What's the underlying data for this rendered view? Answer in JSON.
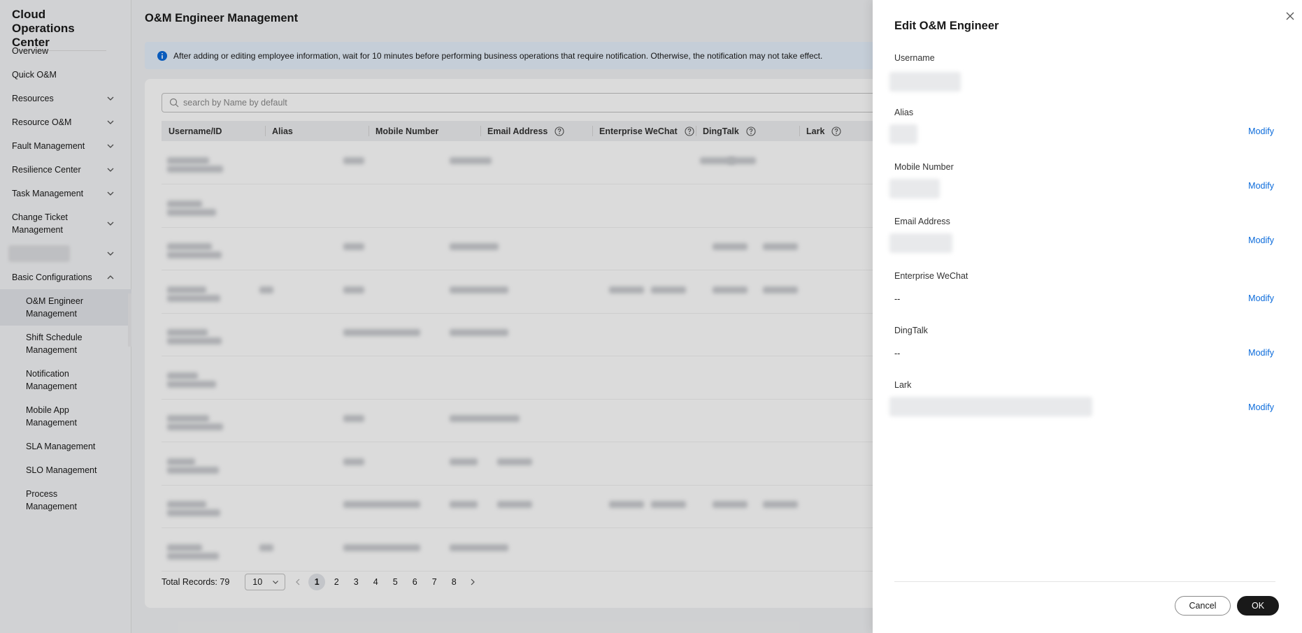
{
  "sidebar": {
    "title": "Cloud Operations Center",
    "items": [
      {
        "label": "Overview",
        "chevron": ""
      },
      {
        "label": "Quick O&M",
        "chevron": ""
      },
      {
        "label": "Resources",
        "chevron": "down"
      },
      {
        "label": "Resource O&M",
        "chevron": "down"
      },
      {
        "label": "Fault Management",
        "chevron": "down"
      },
      {
        "label": "Resilience Center",
        "chevron": "down"
      },
      {
        "label": "Task Management",
        "chevron": "down"
      },
      {
        "label": "Change Ticket Management",
        "chevron": "down"
      },
      {
        "label": "",
        "chevron": "down"
      },
      {
        "label": "Basic Configurations",
        "chevron": "up"
      }
    ],
    "sub_items": [
      {
        "label": "O&M Engineer Management",
        "active": true
      },
      {
        "label": "Shift Schedule Management",
        "active": false
      },
      {
        "label": "Notification Management",
        "active": false
      },
      {
        "label": "Mobile App Management",
        "active": false
      },
      {
        "label": "SLA Management",
        "active": false
      },
      {
        "label": "SLO Management",
        "active": false
      },
      {
        "label": "Process Management",
        "active": false
      }
    ]
  },
  "main": {
    "title": "O&M Engineer Management",
    "notice": "After adding or editing employee information, wait for 10 minutes before performing business operations that require notification. Otherwise, the notification may not take effect.",
    "search_placeholder": "search by Name by default",
    "columns": [
      "Username/ID",
      "Alias",
      "Mobile Number",
      "Email Address",
      "Enterprise WeChat",
      "DingTalk",
      "Lark"
    ],
    "columns_with_help": [
      "Email Address",
      "Enterprise WeChat",
      "DingTalk",
      "Lark"
    ],
    "row_count": 10,
    "pagination": {
      "total_label": "Total Records: 79",
      "page_size": "10",
      "pages": [
        "1",
        "2",
        "3",
        "4",
        "5",
        "6",
        "7",
        "8"
      ],
      "current_page": "1"
    }
  },
  "drawer": {
    "title": "Edit O&M Engineer",
    "fields": [
      {
        "label": "Username",
        "value": "",
        "modify": ""
      },
      {
        "label": "Alias",
        "value": "",
        "modify": "Modify"
      },
      {
        "label": "Mobile Number",
        "value": "",
        "modify": "Modify"
      },
      {
        "label": "Email Address",
        "value": "",
        "modify": "Modify"
      },
      {
        "label": "Enterprise WeChat",
        "value": "--",
        "modify": "Modify"
      },
      {
        "label": "DingTalk",
        "value": "--",
        "modify": "Modify"
      },
      {
        "label": "Lark",
        "value": "",
        "modify": "Modify"
      }
    ],
    "cancel_label": "Cancel",
    "ok_label": "OK"
  },
  "colors": {
    "accent_link": "#0b6bdb",
    "primary_button": "#191919",
    "notice_bg": "#e6f0fc",
    "info_icon": "#0b6bdb"
  }
}
